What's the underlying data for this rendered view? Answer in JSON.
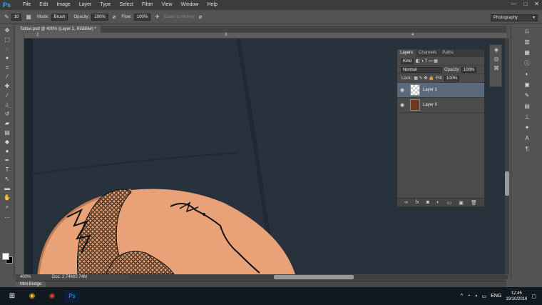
{
  "app": {
    "logo": "Ps"
  },
  "menu": [
    "File",
    "Edit",
    "Image",
    "Layer",
    "Type",
    "Select",
    "Filter",
    "View",
    "Window",
    "Help"
  ],
  "window_controls": [
    "—",
    "□",
    "✕"
  ],
  "options": {
    "mode_label": "Mode:",
    "mode_value": "Brush",
    "opacity_label": "Opacity:",
    "opacity_value": "100%",
    "flow_label": "Flow:",
    "flow_value": "100%",
    "erase_history": "Erase to History",
    "brush_size": "10"
  },
  "workspace": "Photography",
  "document": {
    "tab": "Tattoo.psd @ 400% (Layer 1, RGB/8#) *"
  },
  "ruler": {
    "ticks": [
      "2",
      "3",
      "4"
    ]
  },
  "status": {
    "zoom": "400%",
    "doc": "Doc: 2.74M/2.74M"
  },
  "mini_bridge": "Mini Bridge",
  "layers_panel": {
    "tabs": [
      "Layers",
      "Channels",
      "Paths"
    ],
    "kind": "Kind",
    "blend": "Normal",
    "opacity_label": "Opacity:",
    "opacity_value": "100%",
    "lock_label": "Lock:",
    "fill_label": "Fill:",
    "fill_value": "100%",
    "layers": [
      {
        "name": "Layer 1",
        "selected": true
      },
      {
        "name": "Layer 0",
        "selected": false
      }
    ]
  },
  "taskbar": {
    "lang": "ENG",
    "time": "12:45",
    "date": "19/10/2016"
  },
  "colors": {
    "accent": "#31a8ff",
    "shirt": "#26313c",
    "skin": "#e9a277"
  }
}
